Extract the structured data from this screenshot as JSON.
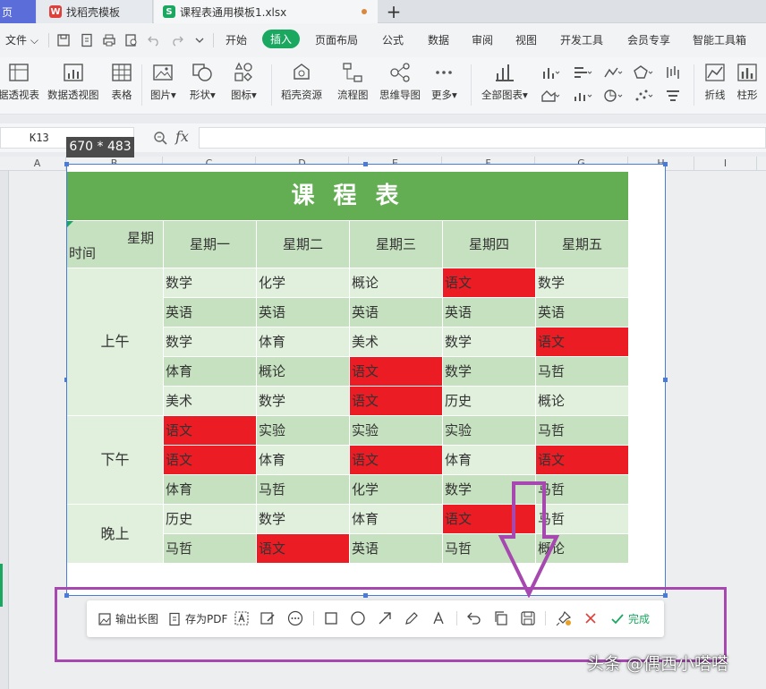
{
  "tabs": {
    "home": "页",
    "store": "找稻壳模板",
    "file": "课程表通用模板1.xlsx",
    "add": "+"
  },
  "menu": {
    "file": "文件",
    "items": [
      "开始",
      "插入",
      "页面布局",
      "公式",
      "数据",
      "审阅",
      "视图",
      "开发工具",
      "会员专享",
      "智能工具箱"
    ],
    "active": "插入"
  },
  "ribbon": {
    "buttons": [
      "据透视表",
      "数据透视图",
      "表格",
      "图片",
      "形状",
      "图标",
      "稻壳资源",
      "流程图",
      "思维导图",
      "更多",
      "全部图表",
      "折线",
      "柱形"
    ]
  },
  "formula_bar": {
    "cell_ref": "K13",
    "fx": "fx",
    "formula": ""
  },
  "columns": [
    "A",
    "B",
    "C",
    "D",
    "E",
    "F",
    "G",
    "H",
    "I"
  ],
  "selection": {
    "size_label": "670 * 483"
  },
  "schedule": {
    "title": "课 程 表",
    "corner_top": "星期",
    "corner_bottom": "时间",
    "days": [
      "星期一",
      "星期二",
      "星期三",
      "星期四",
      "星期五"
    ],
    "periods": [
      "上午",
      "下午",
      "晚上"
    ],
    "rows": [
      [
        "数学",
        "化学",
        "概论",
        "语文",
        "数学"
      ],
      [
        "英语",
        "英语",
        "英语",
        "英语",
        "英语"
      ],
      [
        "数学",
        "体育",
        "美术",
        "数学",
        "语文"
      ],
      [
        "体育",
        "概论",
        "语文",
        "数学",
        "马哲"
      ],
      [
        "美术",
        "数学",
        "语文",
        "历史",
        "概论"
      ],
      [
        "语文",
        "实验",
        "实验",
        "实验",
        "马哲"
      ],
      [
        "语文",
        "体育",
        "语文",
        "体育",
        "语文"
      ],
      [
        "体育",
        "马哲",
        "化学",
        "数学",
        "马哲"
      ],
      [
        "历史",
        "数学",
        "体育",
        "语文",
        "马哲"
      ],
      [
        "马哲",
        "语文",
        "英语",
        "马哲",
        "概论"
      ]
    ],
    "highlight": "语文",
    "colors": {
      "title_bg": "#63ad52",
      "light": "#e1f0dd",
      "mid": "#c6e1bf",
      "highlight": "#ec1c24"
    }
  },
  "snip_toolbar": {
    "export_long": "输出长图",
    "save_pdf": "存为PDF",
    "done": "完成"
  },
  "annotation_color": "#a648b0",
  "watermark": "头条 @偶西小嗒嗒"
}
